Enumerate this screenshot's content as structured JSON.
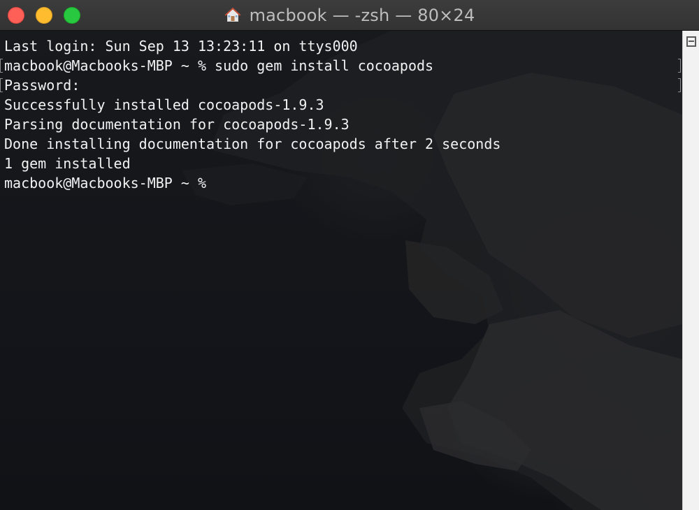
{
  "window": {
    "title": "macbook — -zsh — 80×24",
    "title_icon": "home-folder-icon",
    "buttons": {
      "close": {
        "icon": "close-icon",
        "color": "#fe5f57"
      },
      "minimize": {
        "icon": "minimize-icon",
        "color": "#febc2e"
      },
      "zoom": {
        "icon": "zoom-icon",
        "color": "#28c840"
      }
    }
  },
  "terminal": {
    "lines": [
      {
        "text": "Last login: Sun Sep 13 13:23:11 on ttys000",
        "marked": false
      },
      {
        "text": "macbook@Macbooks-MBP ~ % sudo gem install cocoapods",
        "marked": true
      },
      {
        "text": "Password:",
        "marked": true
      },
      {
        "text": "Successfully installed cocoapods-1.9.3",
        "marked": false
      },
      {
        "text": "Parsing documentation for cocoapods-1.9.3",
        "marked": false
      },
      {
        "text": "Done installing documentation for cocoapods after 2 seconds",
        "marked": false
      },
      {
        "text": "1 gem installed",
        "marked": false
      },
      {
        "text": "macbook@Macbooks-MBP ~ % ",
        "marked": false
      }
    ],
    "text_color": "#f2f2f2"
  },
  "scrollbar": {
    "icon": "split-pane-icon"
  }
}
